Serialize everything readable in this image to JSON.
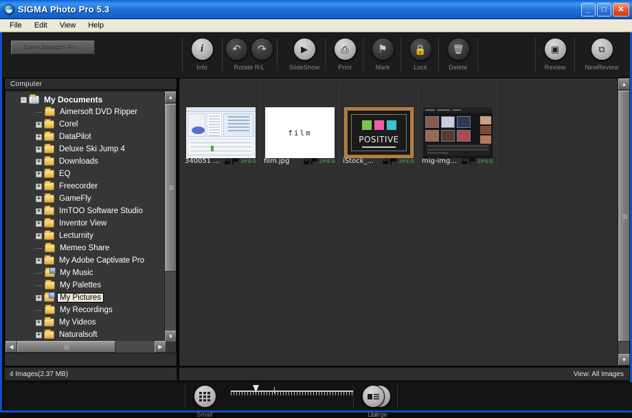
{
  "window": {
    "title": "SIGMA Photo Pro 5.3",
    "icon": "app-logo-icon",
    "buttons": {
      "minimize": "_",
      "maximize": "□",
      "close": "✕"
    }
  },
  "menubar": {
    "items": [
      "File",
      "Edit",
      "View",
      "Help"
    ]
  },
  "toolbar": {
    "save_as_label": "Save Images As...",
    "buttons": [
      {
        "label": "Info",
        "icon": "info-icon",
        "glyph": "i",
        "style": "light"
      },
      {
        "label": "Rotate R/L",
        "icon": "rotate-left-right-icon",
        "glyph": "↶",
        "glyph2": "↷",
        "style": "dark"
      },
      {
        "label": "SlideShow",
        "icon": "play-icon",
        "glyph": "▶",
        "style": "light"
      },
      {
        "label": "Print",
        "icon": "printer-icon",
        "glyph": "⎙",
        "style": "light"
      },
      {
        "label": "Mark",
        "icon": "flag-icon",
        "glyph": "⚑",
        "style": "dark"
      },
      {
        "label": "Lock",
        "icon": "lock-icon",
        "glyph": "ὑ2",
        "style": "dark"
      },
      {
        "label": "Delete",
        "icon": "trash-icon",
        "glyph": "⌧",
        "style": "dark"
      }
    ],
    "right_buttons": [
      {
        "label": "Review",
        "icon": "review-window-icon",
        "glyph": "▣"
      },
      {
        "label": "NewReview",
        "icon": "new-review-window-icon",
        "glyph": "⧉"
      }
    ]
  },
  "tree_panel": {
    "header": "Computer",
    "items": [
      {
        "label": "My Documents",
        "depth": 0,
        "expander": "-",
        "icon": "my-documents-folder-icon",
        "selected": false
      },
      {
        "label": "Aimersoft DVD Ripper",
        "depth": 1,
        "expander": "",
        "icon": "folder-icon",
        "selected": false
      },
      {
        "label": "Corel",
        "depth": 1,
        "expander": "+",
        "icon": "folder-icon",
        "selected": false
      },
      {
        "label": "DataPilot",
        "depth": 1,
        "expander": "+",
        "icon": "folder-icon",
        "selected": false
      },
      {
        "label": "Deluxe Ski Jump 4",
        "depth": 1,
        "expander": "+",
        "icon": "folder-icon",
        "selected": false
      },
      {
        "label": "Downloads",
        "depth": 1,
        "expander": "+",
        "icon": "folder-icon",
        "selected": false
      },
      {
        "label": "EQ",
        "depth": 1,
        "expander": "+",
        "icon": "folder-icon",
        "selected": false
      },
      {
        "label": "Freecorder",
        "depth": 1,
        "expander": "+",
        "icon": "folder-icon",
        "selected": false
      },
      {
        "label": "GameFly",
        "depth": 1,
        "expander": "+",
        "icon": "folder-icon",
        "selected": false
      },
      {
        "label": "ImTOO Software Studio",
        "depth": 1,
        "expander": "+",
        "icon": "folder-icon",
        "selected": false
      },
      {
        "label": "Inventor View",
        "depth": 1,
        "expander": "+",
        "icon": "folder-icon",
        "selected": false
      },
      {
        "label": "Lecturnity",
        "depth": 1,
        "expander": "+",
        "icon": "folder-icon",
        "selected": false
      },
      {
        "label": "Memeo Share",
        "depth": 1,
        "expander": "",
        "icon": "folder-icon",
        "selected": false
      },
      {
        "label": "My Adobe Captivate Pro",
        "depth": 1,
        "expander": "+",
        "icon": "folder-icon",
        "selected": false
      },
      {
        "label": "My Music",
        "depth": 1,
        "expander": "",
        "icon": "my-music-folder-icon",
        "selected": false
      },
      {
        "label": "My Palettes",
        "depth": 1,
        "expander": "",
        "icon": "folder-icon",
        "selected": false
      },
      {
        "label": "My Pictures",
        "depth": 1,
        "expander": "+",
        "icon": "my-pictures-folder-icon",
        "selected": true
      },
      {
        "label": "My Recordings",
        "depth": 1,
        "expander": "",
        "icon": "folder-icon",
        "selected": false
      },
      {
        "label": "My Videos",
        "depth": 1,
        "expander": "+",
        "icon": "folder-icon",
        "selected": false
      },
      {
        "label": "Naturalsoft",
        "depth": 1,
        "expander": "+",
        "icon": "folder-icon",
        "selected": false
      }
    ]
  },
  "thumbnails": [
    {
      "name": "340051 ...",
      "format": "JPEG",
      "art": "win",
      "locked": true,
      "marked": true
    },
    {
      "name": "film.jpg",
      "format": "JPEG",
      "art": "film",
      "locked": true,
      "marked": true,
      "text": "film"
    },
    {
      "name": "iStock_...",
      "format": "JPEG",
      "art": "board",
      "locked": true,
      "marked": true,
      "text": "POSITIVE"
    },
    {
      "name": "mig-img...",
      "format": "JPEG",
      "art": "grid",
      "locked": true,
      "marked": true
    }
  ],
  "status": {
    "left": "4 Images(2.37 MB)",
    "right": "View: All Images"
  },
  "bottombar": {
    "small_label": "Small",
    "large_label": "Large",
    "list_label": "List",
    "small_icon": "small-grid-icon",
    "large_icon": "large-thumb-icon",
    "list_icon": "list-view-icon",
    "slider_value": 18
  },
  "colors": {
    "titlebar_blue": "#1d6fd8",
    "accent_border": "#0d52c8",
    "menubar_bg": "#ece9d8",
    "panel_bg": "#2f2f2f",
    "jpeg_green": "#4f8f4f",
    "selection_bg": "#ece9d8"
  }
}
